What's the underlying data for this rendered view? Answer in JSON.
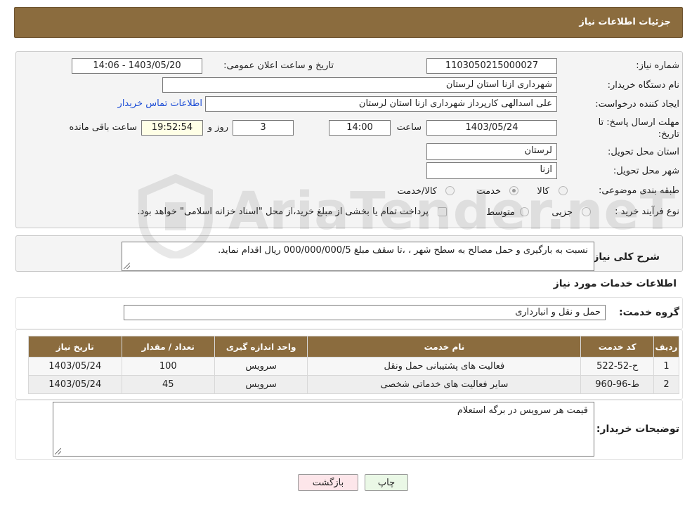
{
  "header": {
    "title": "جزئیات اطلاعات نیاز"
  },
  "need": {
    "number_label": "شماره نیاز:",
    "number_value": "1103050215000027",
    "announce_label": "تاریخ و ساعت اعلان عمومی:",
    "announce_value": "1403/05/20 - 14:06",
    "buyer_org_label": "نام دستگاه خریدار:",
    "buyer_org_value": "شهرداری ازنا استان لرستان",
    "creator_label": "ایجاد کننده درخواست:",
    "creator_value": "علی اسدالهی کارپرداز شهرداری ازنا استان لرستان",
    "contact_link": "اطلاعات تماس خریدار",
    "deadline_label": "مهلت ارسال پاسخ: تا تاریخ:",
    "deadline_date": "1403/05/24",
    "time_label": "ساعت",
    "deadline_time": "14:00",
    "days_value": "3",
    "days_label": "روز و",
    "remaining_value": "19:52:54",
    "remaining_label": "ساعت باقی مانده",
    "province_label": "استان محل تحویل:",
    "province_value": "لرستان",
    "city_label": "شهر محل تحویل:",
    "city_value": "ازنا",
    "category_label": "طبقه بندی موضوعی:",
    "category_options": [
      "کالا",
      "خدمت",
      "کالا/خدمت"
    ],
    "category_selected": "خدمت",
    "process_label": "نوع فرآیند خرید :",
    "process_options": [
      "جزیی",
      "متوسط"
    ],
    "payment_note": "پرداخت تمام یا بخشی از مبلغ خرید،از محل \"اسناد خزانه اسلامی\" خواهد بود."
  },
  "summary": {
    "label": "شرح کلی نیاز:",
    "text": "نسبت به بارگیری و حمل مصالح به سطح شهر ، ،تا سقف مبلغ  000/000/000/5 ریال اقدام نماید."
  },
  "services": {
    "section_title": "اطلاعات خدمات مورد نیاز",
    "group_label": "گروه خدمت:",
    "group_value": "حمل و نقل و انبارداری",
    "columns": [
      "ردیف",
      "کد خدمت",
      "نام خدمت",
      "واحد اندازه گیری",
      "تعداد / مقدار",
      "تاریخ نیاز"
    ],
    "rows": [
      [
        "1",
        "ح-52-522",
        "فعالیت های پشتیبانی حمل ونقل",
        "سرویس",
        "100",
        "1403/05/24"
      ],
      [
        "2",
        "ط-96-960",
        "سایر فعالیت های خدماتی شخصی",
        "سرویس",
        "45",
        "1403/05/24"
      ]
    ]
  },
  "buyer_notes": {
    "label": "توضیحات خریدار:",
    "text": "قیمت هر سرویس در برگه استعلام"
  },
  "buttons": {
    "print": "چاپ",
    "back": "بازگشت"
  },
  "watermark": {
    "text": "AriaTender.neT"
  },
  "colors": {
    "header": "#8b6c3e",
    "back_button": "#fde6ea",
    "print_button": "#eaf8e6",
    "link": "#1f4fd6"
  }
}
